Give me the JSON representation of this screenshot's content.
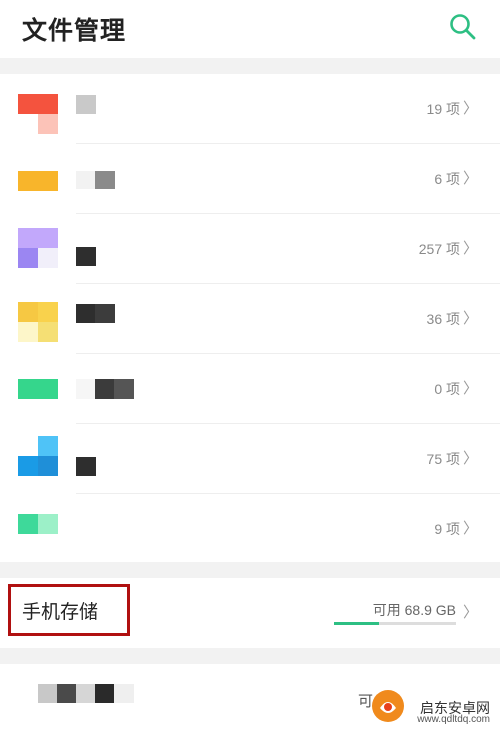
{
  "header": {
    "title": "文件管理",
    "search_icon": "search-icon",
    "accent": "#2dbf83"
  },
  "categories": [
    {
      "icon": "category-icon",
      "count": "19 项",
      "color": "#f4533e"
    },
    {
      "icon": "category-icon",
      "count": "6 项",
      "color": "#f8b52b"
    },
    {
      "icon": "category-icon",
      "count": "257 项",
      "color": "#a78bf5"
    },
    {
      "icon": "category-icon",
      "count": "36 项",
      "color": "#f6c843"
    },
    {
      "icon": "category-icon",
      "count": "0 项",
      "color": "#35d68c"
    },
    {
      "icon": "category-icon",
      "count": "75 项",
      "color": "#1a9be6"
    },
    {
      "icon": "category-icon",
      "count": "9 项",
      "color": "#3ed99a"
    }
  ],
  "chevron": "〉",
  "storage": {
    "label": "手机存储",
    "available": "可用 68.9 GB",
    "used_fraction": 0.37,
    "bar_color": "#2dbf83"
  },
  "bottom": {
    "partial_text": "可"
  },
  "watermark": {
    "name": "启东安卓网",
    "url": "www.qdltdq.com"
  }
}
